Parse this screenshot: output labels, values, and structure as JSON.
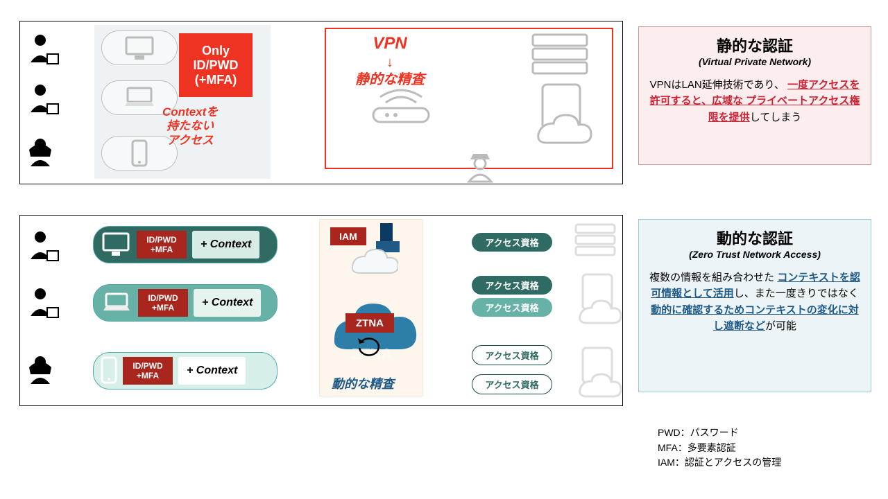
{
  "vpn_panel": {
    "mainbox_line1": "Only",
    "mainbox_line2": "ID/PWD",
    "mainbox_line3": "(+MFA)",
    "context_line1": "Contextを",
    "context_line2": "持たない",
    "context_line3": "アクセス",
    "vpn_label": "VPN",
    "vpn_arrow": "↓",
    "vpn_sub": "静的な精査"
  },
  "ztna_panel": {
    "auth_label_line1": "ID/PWD",
    "auth_label_line2": "+MFA",
    "context_label": "+ Context",
    "iam_label": "IAM",
    "ztna_label": "ZTNA",
    "ztna_sub": "動的な精査",
    "badge": "アクセス資格"
  },
  "legend_red": {
    "title": "静的な認証",
    "sub": "(Virtual Private Network)",
    "body_prefix": "VPNはLAN延伸技術であり、",
    "body_highlight": "一度アクセスを許可すると、広域な プライベートアクセス権限を提供",
    "body_suffix": "してしまう"
  },
  "legend_blue": {
    "title": "動的な認証",
    "sub": "(Zero Trust Network Access)",
    "body_prefix": "複数の情報を組み合わせた",
    "body_highlight1": "コンテキストを認可情報として活用",
    "body_mid": "し、また一度きりではなく",
    "body_highlight2": "動的に確認するためコンテキストの変化に対し遮断など",
    "body_suffix": "が可能"
  },
  "glossary": {
    "pwd": "PWD：パスワード",
    "mfa": "MFA：多要素認証",
    "iam": "IAM：認証とアクセスの管理"
  }
}
